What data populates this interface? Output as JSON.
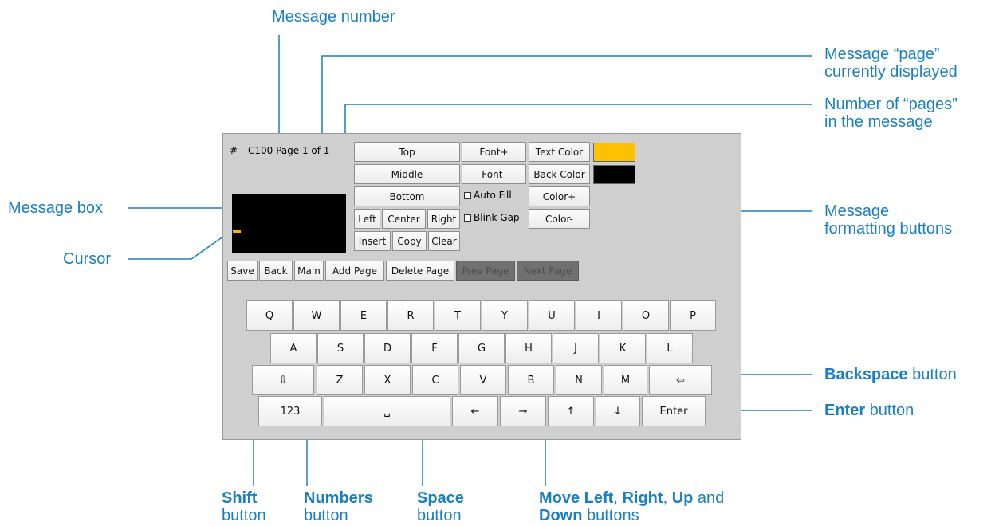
{
  "annotations": {
    "message_number": "Message number",
    "page_displayed_l1": "Message “page”",
    "page_displayed_l2": "currently displayed",
    "pages_count_l1": "Number of “pages”",
    "pages_count_l2": "in the message",
    "message_box": "Message box",
    "cursor": "Cursor",
    "formatting_l1": "Message",
    "formatting_l2": "formatting buttons",
    "backspace_bold": "Backspace",
    "backspace_rest": " button",
    "enter_bold": "Enter",
    "enter_rest": " button",
    "shift_bold": "Shift",
    "shift_rest": "button",
    "numbers_bold": "Numbers",
    "numbers_rest": "button",
    "space_bold": "Space",
    "space_rest": "button",
    "move_bold1": "Move Left",
    "move_sep1": ", ",
    "move_bold2": "Right",
    "move_sep2": ", ",
    "move_bold3": "Up",
    "move_sep3": " and",
    "move_bold4": "Down",
    "move_rest": " buttons"
  },
  "screen": {
    "hash": "#",
    "status": "C100 Page 1 of 1",
    "buttons": {
      "top": "Top",
      "middle": "Middle",
      "bottom": "Bottom",
      "left": "Left",
      "center": "Center",
      "right": "Right",
      "insert": "Insert",
      "copy": "Copy",
      "clear": "Clear",
      "font_plus": "Font+",
      "font_minus": "Font-",
      "auto_fill": "Auto Fill",
      "blink_gap": "Blink Gap",
      "text_color": "Text Color",
      "back_color": "Back Color",
      "color_plus": "Color+",
      "color_minus": "Color-",
      "save": "Save",
      "back": "Back",
      "main": "Main",
      "add_page": "Add Page",
      "delete_page": "Delete Page",
      "prev_page": "Prev Page",
      "next_page": "Next Page"
    },
    "colors": {
      "text_color": "#ffc000",
      "back_color": "#000000",
      "cursor": "#f6b800"
    }
  },
  "keyboard": {
    "row1": [
      "Q",
      "W",
      "E",
      "R",
      "T",
      "Y",
      "U",
      "I",
      "O",
      "P"
    ],
    "row2": [
      "A",
      "S",
      "D",
      "F",
      "G",
      "H",
      "J",
      "K",
      "L"
    ],
    "row3": [
      "⇩",
      "Z",
      "X",
      "C",
      "V",
      "B",
      "N",
      "M",
      "⇦"
    ],
    "row4": [
      "123",
      "␣",
      "←",
      "→",
      "↑",
      "↓",
      "Enter"
    ]
  }
}
